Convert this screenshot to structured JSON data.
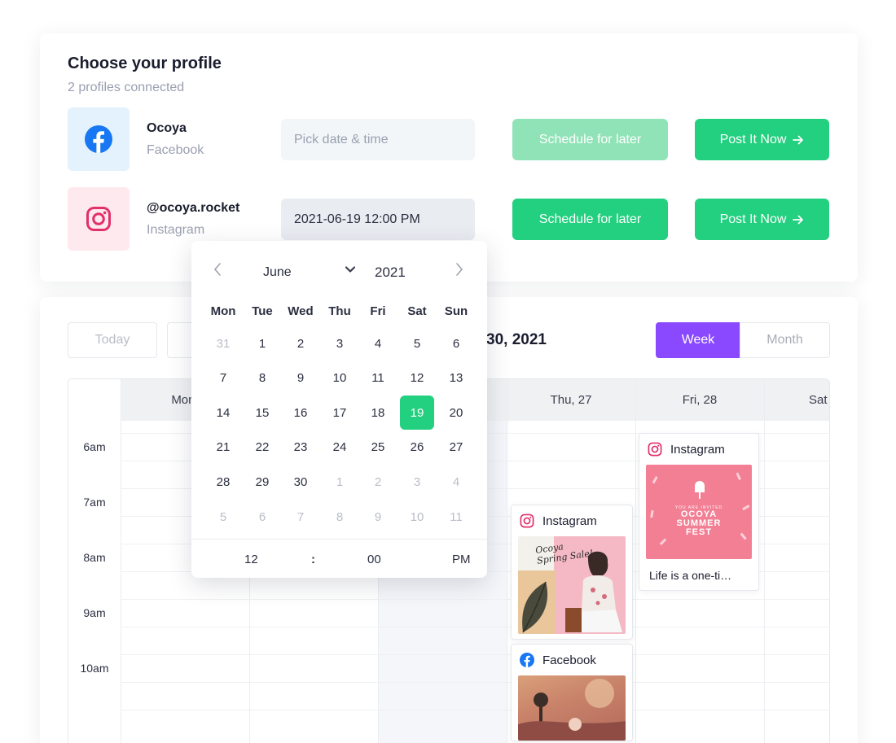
{
  "profiles": {
    "title": "Choose your profile",
    "subtitle": "2 profiles connected",
    "items": [
      {
        "name": "Ocoya",
        "network": "Facebook",
        "icon": "facebook-icon",
        "datetime_placeholder": "Pick date & time",
        "datetime_value": "",
        "schedule_label": "Schedule for later",
        "schedule_enabled": false,
        "post_label": "Post It Now"
      },
      {
        "name": "@ocoya.rocket",
        "network": "Instagram",
        "icon": "instagram-icon",
        "datetime_placeholder": "",
        "datetime_value": "2021-06-19 12:00 PM",
        "schedule_label": "Schedule for later",
        "schedule_enabled": true,
        "post_label": "Post It Now"
      }
    ]
  },
  "calendar": {
    "today_label": "Today",
    "range_title": "30, 2021",
    "view_week": "Week",
    "view_month": "Month",
    "active_view": "Week",
    "days": [
      "Mon,",
      "",
      "",
      "Thu, 27",
      "Fri, 28",
      "Sat"
    ],
    "hours": [
      "6am",
      "7am",
      "8am",
      "9am",
      "10am"
    ],
    "posts": [
      {
        "network": "Instagram",
        "day": "Thu, 27",
        "start": "7:15am",
        "has_image": true
      },
      {
        "network": "Facebook",
        "day": "Thu, 27",
        "start": "9:45am",
        "has_image": true
      },
      {
        "network": "Instagram",
        "day": "Fri, 28",
        "start": "5:50am",
        "has_image": true,
        "caption": "Life is a one-ti…"
      }
    ],
    "images": {
      "summer_fest": {
        "line1": "YOU ARE INVITED",
        "line2": "OCOYA",
        "line3": "SUMMER",
        "line4": "FEST"
      },
      "spring_sale": {
        "line1": "Ocoya",
        "line2": "Spring Sale!"
      }
    }
  },
  "datepicker": {
    "month": "June",
    "year": "2021",
    "weekdays": [
      "Mon",
      "Tue",
      "Wed",
      "Thu",
      "Fri",
      "Sat",
      "Sun"
    ],
    "weeks": [
      [
        "31",
        "1",
        "2",
        "3",
        "4",
        "5",
        "6"
      ],
      [
        "7",
        "8",
        "9",
        "10",
        "11",
        "12",
        "13"
      ],
      [
        "14",
        "15",
        "16",
        "17",
        "18",
        "19",
        "20"
      ],
      [
        "21",
        "22",
        "23",
        "24",
        "25",
        "26",
        "27"
      ],
      [
        "28",
        "29",
        "30",
        "1",
        "2",
        "3",
        "4"
      ],
      [
        "5",
        "6",
        "7",
        "8",
        "9",
        "10",
        "11"
      ]
    ],
    "selected": "19",
    "hour": "12",
    "separator": ":",
    "minute": "00",
    "ampm": "PM"
  },
  "colors": {
    "accent_green": "#22d07f",
    "accent_green_disabled": "#90e3b7",
    "accent_purple": "#8a49ff",
    "facebook_blue": "#1877f2",
    "instagram_pink": "#e1306c"
  }
}
